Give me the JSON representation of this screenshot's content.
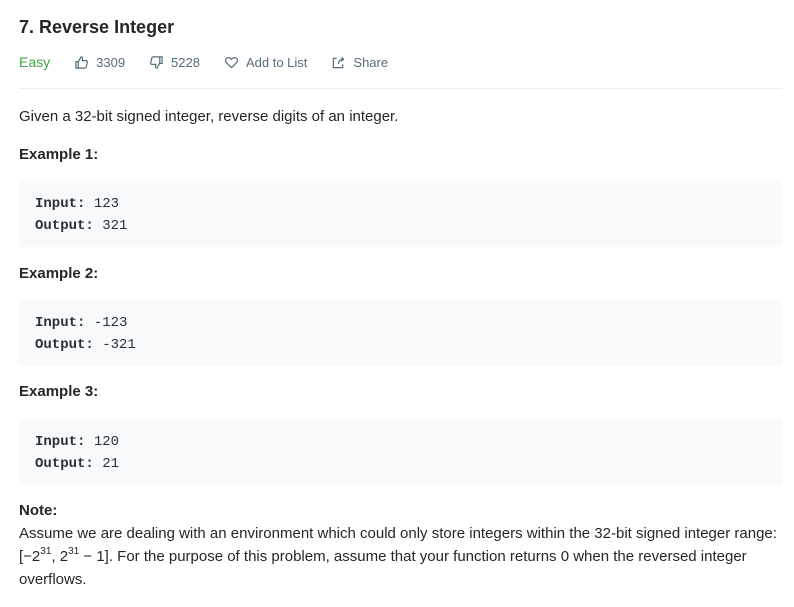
{
  "problem": {
    "title": "7. Reverse Integer",
    "difficulty": "Easy",
    "likes": "3309",
    "dislikes": "5228",
    "add_to_list": "Add to List",
    "share": "Share",
    "description": "Given a 32-bit signed integer, reverse digits of an integer."
  },
  "examples": [
    {
      "heading": "Example 1:",
      "input_label": "Input:",
      "input": "123",
      "output_label": "Output:",
      "output": "321"
    },
    {
      "heading": "Example 2:",
      "input_label": "Input:",
      "input": "-123",
      "output_label": "Output:",
      "output": "-321"
    },
    {
      "heading": "Example 3:",
      "input_label": "Input:",
      "input": "120",
      "output_label": "Output:",
      "output": "21"
    }
  ],
  "note": {
    "heading": "Note:",
    "text_part1": "Assume we are dealing with an environment which could only store integers within the 32-bit signed integer range: [−2",
    "exp1": "31",
    "text_part2": ",  2",
    "exp2": "31",
    "text_part3": " − 1]. For the purpose of this problem, assume that your function returns 0 when the reversed integer overflows."
  },
  "colors": {
    "difficulty_easy": "#43a047",
    "meta_text": "#546e7a",
    "code_bg": "#f7f9fa"
  },
  "icons": [
    "thumbs-up-icon",
    "thumbs-down-icon",
    "heart-icon",
    "share-icon"
  ]
}
